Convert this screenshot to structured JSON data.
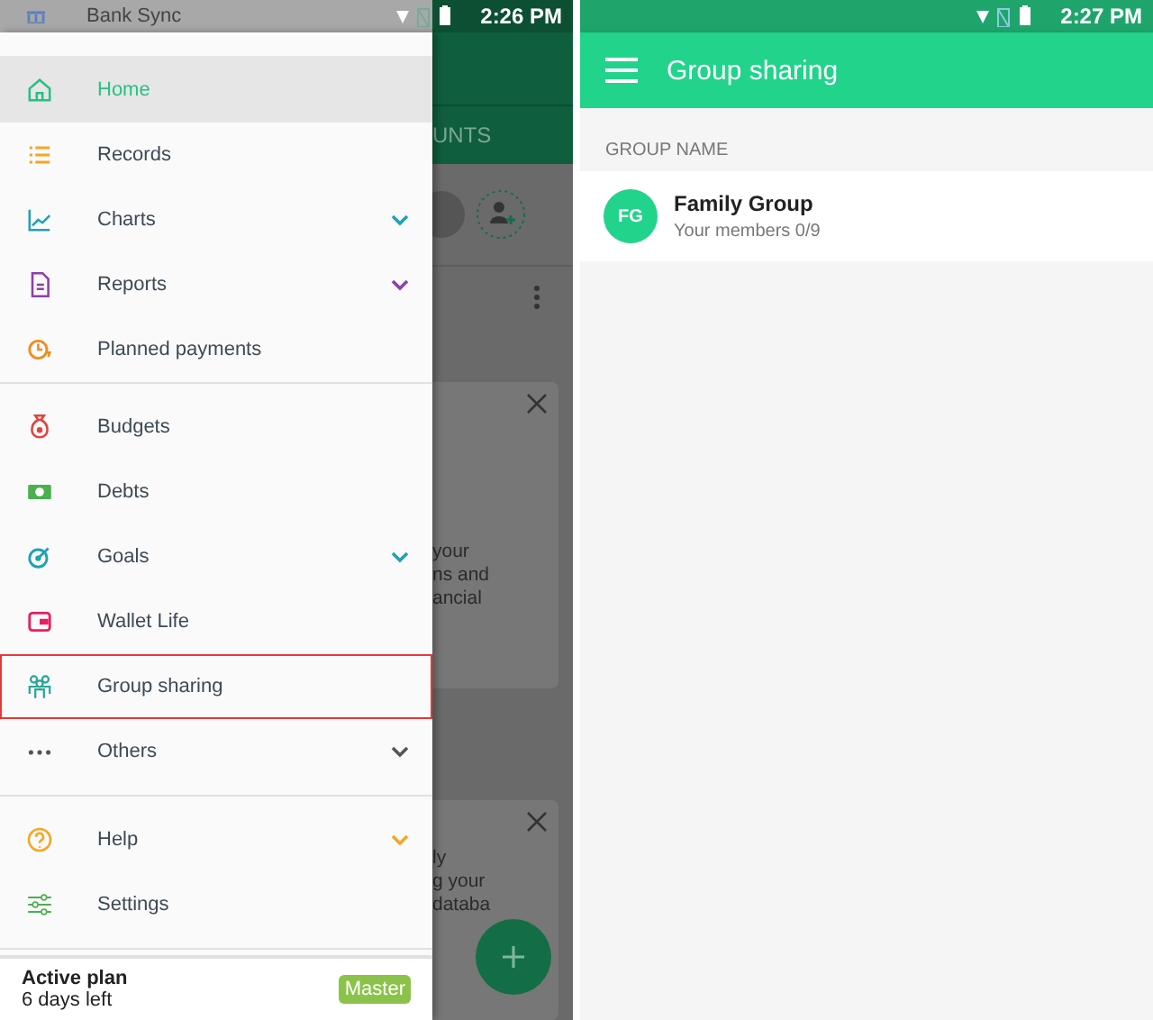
{
  "left_screen": {
    "status_bar": {
      "time": "2:26 PM"
    },
    "drawer": {
      "top_item": "Bank Sync",
      "groups": [
        {
          "items": [
            {
              "label": "Home",
              "selected": true,
              "expandable": false,
              "outlined": false,
              "color": "#26c281"
            },
            {
              "label": "Records",
              "selected": false,
              "expandable": false,
              "outlined": false,
              "color": "#f5a623"
            },
            {
              "label": "Charts",
              "selected": false,
              "expandable": true,
              "outlined": false,
              "color": "#1fa2b5"
            },
            {
              "label": "Reports",
              "selected": false,
              "expandable": true,
              "outlined": false,
              "color": "#8e3fa8"
            },
            {
              "label": "Planned payments",
              "selected": false,
              "expandable": false,
              "outlined": false,
              "color": "#f08c1e"
            }
          ]
        },
        {
          "items": [
            {
              "label": "Budgets",
              "selected": false,
              "expandable": false,
              "outlined": false,
              "color": "#e0443e"
            },
            {
              "label": "Debts",
              "selected": false,
              "expandable": false,
              "outlined": false,
              "color": "#4caf50"
            },
            {
              "label": "Goals",
              "selected": false,
              "expandable": true,
              "outlined": false,
              "color": "#1fa2b5"
            },
            {
              "label": "Wallet Life",
              "selected": false,
              "expandable": false,
              "outlined": false,
              "color": "#e91e63"
            },
            {
              "label": "Group sharing",
              "selected": false,
              "expandable": false,
              "outlined": true,
              "color": "#26a69a"
            },
            {
              "label": "Others",
              "selected": false,
              "expandable": true,
              "outlined": false,
              "color": "#555555"
            }
          ]
        },
        {
          "items": [
            {
              "label": "Help",
              "selected": false,
              "expandable": true,
              "outlined": false,
              "color": "#f5a623"
            },
            {
              "label": "Settings",
              "selected": false,
              "expandable": false,
              "outlined": false,
              "color": "#4caf50"
            }
          ]
        }
      ],
      "footer": {
        "plan_label": "Active plan",
        "days_left": "6 days left",
        "badge": "Master"
      }
    },
    "background": {
      "tab": "UNTS",
      "card_1_lines": [
        "your",
        "ns and",
        "ancial"
      ],
      "card_2_lines": [
        "ly",
        "g your",
        "databa"
      ]
    }
  },
  "right_screen": {
    "status_bar": {
      "time": "2:27 PM"
    },
    "app_bar": {
      "title": "Group sharing"
    },
    "section_header": "GROUP NAME",
    "groups": [
      {
        "initials": "FG",
        "name": "Family Group",
        "members": "Your members 0/9"
      }
    ]
  }
}
